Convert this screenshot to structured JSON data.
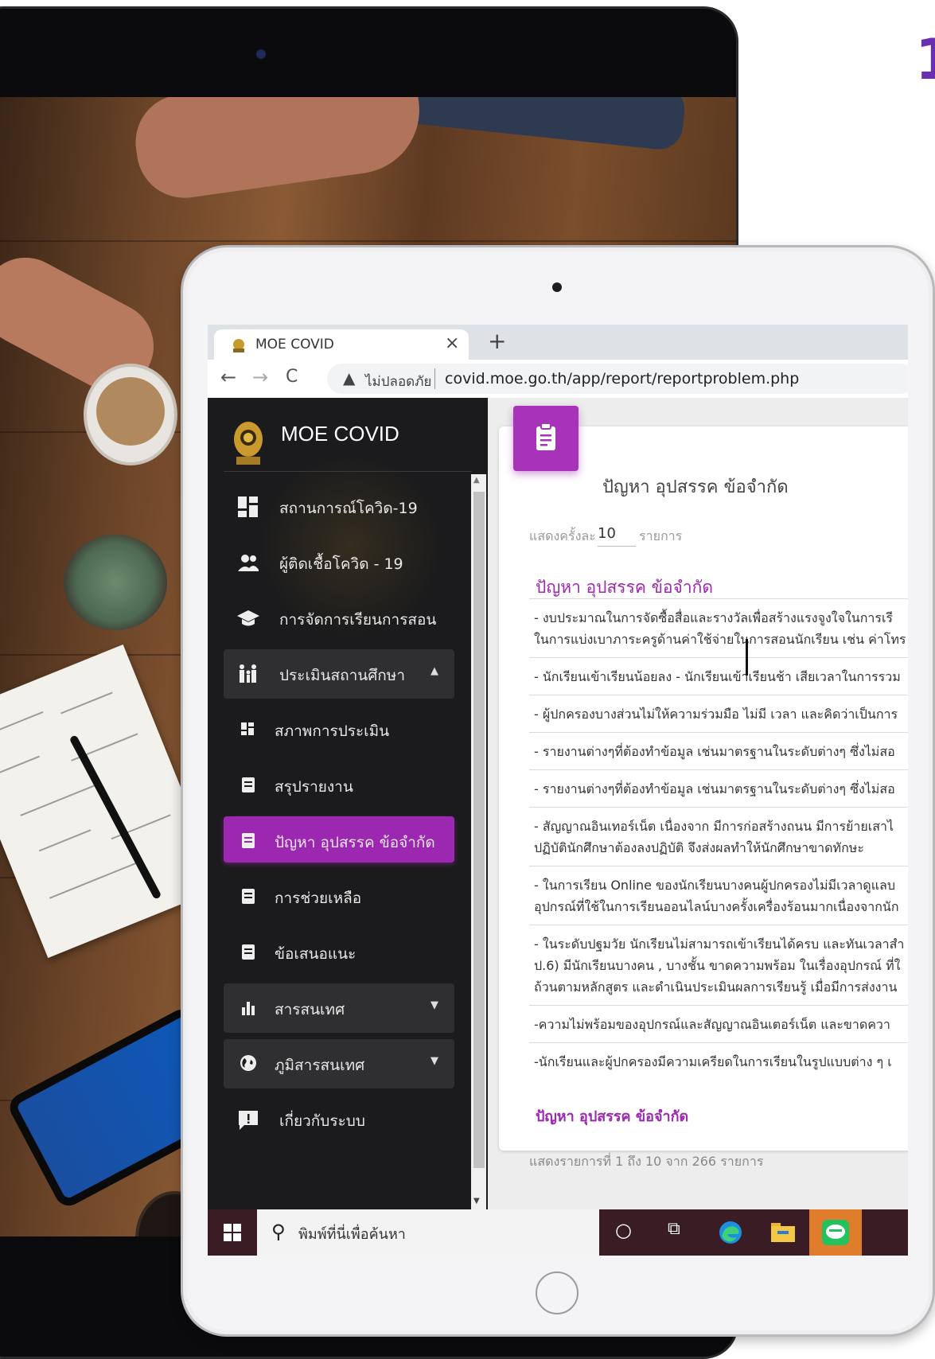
{
  "browser": {
    "tab_title": "MOE COVID",
    "tab_close": "×",
    "new_tab": "+",
    "back": "←",
    "forward": "→",
    "reload": "C",
    "security_text": "ไม่ปลอดภัย",
    "url": "covid.moe.go.th/app/report/reportproblem.php"
  },
  "sidebar": {
    "brand": "MOE COVID",
    "items": [
      {
        "label": "สถานการณ์โควิด-19",
        "icon": "dashboard-icon"
      },
      {
        "label": "ผู้ติดเชื้อโควิด - 19",
        "icon": "people-icon"
      },
      {
        "label": "การจัดการเรียนการสอน",
        "icon": "graduation-cap-icon"
      },
      {
        "label": "ประเมินสถานศึกษา",
        "icon": "family-icon",
        "expanded": true
      },
      {
        "label": "สภาพการประเมิน",
        "icon": "dashboard-small-icon"
      },
      {
        "label": "สรุปรายงาน",
        "icon": "document-icon"
      },
      {
        "label": "ปัญหา อุปสรรค ข้อจำกัด",
        "icon": "document-icon",
        "active": true
      },
      {
        "label": "การช่วยเหลือ",
        "icon": "document-icon"
      },
      {
        "label": "ข้อเสนอแนะ",
        "icon": "document-icon"
      },
      {
        "label": "สารสนเทศ",
        "icon": "bar-chart-icon"
      },
      {
        "label": "ภูมิสารสนเทศ",
        "icon": "globe-icon"
      },
      {
        "label": "เกี่ยวกับระบบ",
        "icon": "info-message-icon"
      }
    ]
  },
  "main": {
    "card_title": "ปัญหา อุปสรรค ข้อจำกัด",
    "length_prefix": "แสดงครั้งละ",
    "length_value": "10",
    "length_suffix": "รายการ",
    "column_header": "ปัญหา อุปสรรค ข้อจำกัด",
    "rows": [
      [
        "- งบประมาณในการจัดซื้อสื่อและรางวัลเพื่อสร้างแรงจูงใจในการเรี",
        "ในการแบ่งเบาภาระครูด้านค่าใช้จ่ายในการสอนนักเรียน เช่น ค่าโทร"
      ],
      [
        "- นักเรียนเข้าเรียนน้อยลง - นักเรียนเข้าเรียนช้า เสียเวลาในการรวม"
      ],
      [
        "- ผู้ปกครองบางส่วนไม่ให้ความร่วมมือ ไม่มี เวลา และคิดว่าเป็นการ"
      ],
      [
        "- รายงานต่างๆที่ต้องทำข้อมูล เช่นมาตรฐานในระดับต่างๆ ซึ่งไม่สอ"
      ],
      [
        "- รายงานต่างๆที่ต้องทำข้อมูล เช่นมาตรฐานในระดับต่างๆ ซึ่งไม่สอ"
      ],
      [
        "- สัญญาณอินเทอร์เน็ต เนื่องจาก มีการก่อสร้างถนน มีการย้ายเสาไ",
        "ปฏิบัตินักศึกษาต้องลงปฏิบัติ จึงส่งผลทำให้นักศึกษาขาดทักษะ"
      ],
      [
        "- ในการเรียน Online ของนักเรียนบางคนผู้ปกครองไม่มีเวลาดูแลบ",
        "อุปกรณ์ที่ใช้ในการเรียนออนไลน์บางครั้งเครื่องร้อนมากเนื่องจากนัก"
      ],
      [
        "- ในระดับปฐมวัย นักเรียนไม่สามารถเข้าเรียนได้ครบ และทันเวลาสำ",
        "ป.6) มีนักเรียนบางคน , บางชั้น ขาดความพร้อม ในเรื่องอุปกรณ์ ที่ใ",
        "ถ้วนตามหลักสูตร และดำเนินประเมินผลการเรียนรู้ เมื่อมีการส่งงาน"
      ],
      [
        "-ความไม่พร้อมของอุปกรณ์และสัญญาณอินเตอร์เน็ต และขาดควา"
      ],
      [
        "-นักเรียนและผู้ปกครองมีความเครียดในการเรียนในรูปแบบต่าง ๆ เ"
      ]
    ],
    "column_footer": "ปัญหา อุปสรรค ข้อจำกัด",
    "info": "แสดงรายการที่ 1 ถึง 10 จาก 266 รายการ"
  },
  "taskbar": {
    "search_placeholder": "พิมพ์ที่นี่เพื่อค้นหา",
    "icons": [
      "cortana-icon",
      "task-view-icon",
      "edge-icon",
      "file-explorer-icon",
      "line-app-icon"
    ]
  },
  "colors": {
    "accent": "#9c27b0",
    "sidebar_bg": "#1b1b1d",
    "taskbar_bg": "#3a1c24"
  }
}
